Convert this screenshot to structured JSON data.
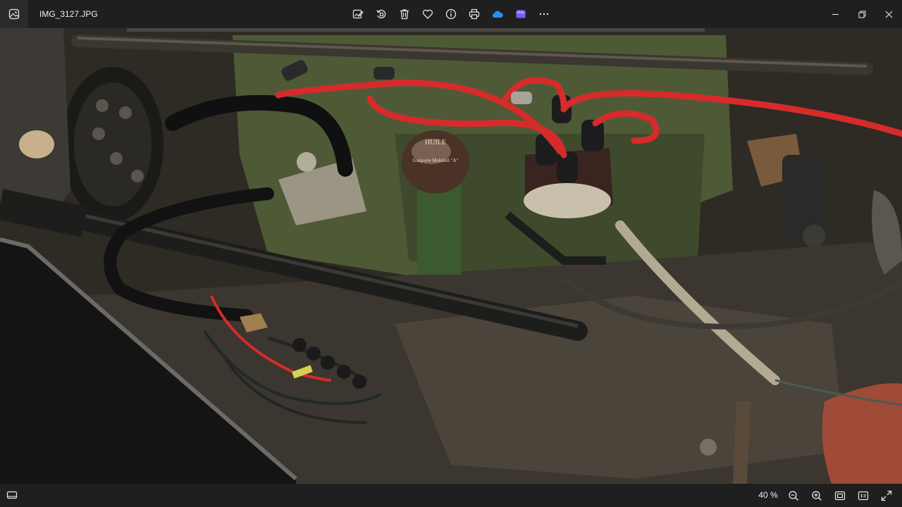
{
  "window": {
    "file_name": "IMG_3127.JPG"
  },
  "toolbar": {
    "items": [
      {
        "name": "edit-image",
        "icon": "edit-image-icon"
      },
      {
        "name": "rotate",
        "icon": "rotate-icon"
      },
      {
        "name": "delete",
        "icon": "trash-icon"
      },
      {
        "name": "favorite",
        "icon": "heart-icon"
      },
      {
        "name": "file-info",
        "icon": "info-icon"
      },
      {
        "name": "print",
        "icon": "printer-icon"
      },
      {
        "name": "onedrive",
        "icon": "cloud-icon"
      },
      {
        "name": "clipchamp",
        "icon": "clipchamp-icon"
      },
      {
        "name": "more-options",
        "icon": "ellipsis-icon"
      }
    ]
  },
  "photo": {
    "label_huile": "HUILE",
    "label_brand": "Gargoyle Mobiloil \"A\""
  },
  "statusbar": {
    "zoom_level": "40 %"
  },
  "colors": {
    "titlebar_bg": "#1f1f1f",
    "icon_fg": "#e8e8e8",
    "onedrive_blue": "#2a8ff0",
    "clipchamp_purple": "#7b5cff",
    "ignition_wire_red": "#d62b2b",
    "engine_block_green": "#4e5a36"
  }
}
